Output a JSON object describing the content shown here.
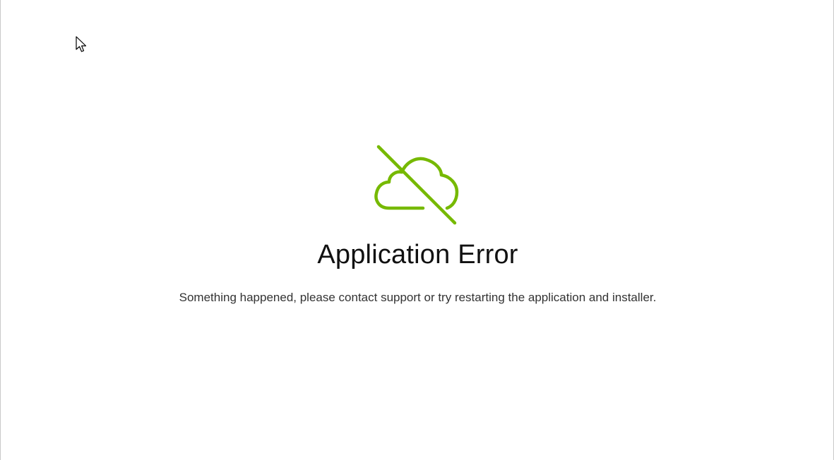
{
  "error_page": {
    "icon": "cloud-off-icon",
    "title": "Application Error",
    "message": "Something happened, please contact support or try restarting the application and installer."
  },
  "colors": {
    "accent": "#76b900",
    "title": "#111111",
    "message": "#333333",
    "background": "#ffffff"
  },
  "cursor": {
    "icon": "mouse-pointer-icon"
  }
}
